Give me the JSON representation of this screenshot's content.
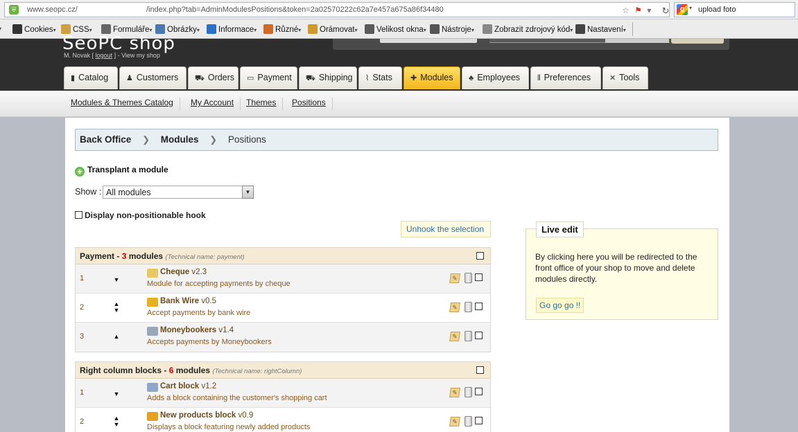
{
  "browser": {
    "url_host": "www.seopc.cz/",
    "url_path": "/index.php?tab=AdminModulesPositions&token=2a02570222c62a7e457a675a86f34480",
    "search_text": "upload foto"
  },
  "toolbar": {
    "items": [
      {
        "label": "Cookies",
        "icon": "person-icon",
        "color": "#333333"
      },
      {
        "label": "CSS",
        "icon": "wand-icon",
        "color": "#d0a040"
      },
      {
        "label": "Formuláře",
        "icon": "form-icon",
        "color": "#666666"
      },
      {
        "label": "Obrázky",
        "icon": "image-icon",
        "color": "#4a78b0"
      },
      {
        "label": "Informace",
        "icon": "info-icon",
        "color": "#2a6fc8"
      },
      {
        "label": "Různé",
        "icon": "misc-icon",
        "color": "#d06a2a"
      },
      {
        "label": "Orámovat",
        "icon": "pencil-icon",
        "color": "#d09a2a"
      },
      {
        "label": "Velikost okna",
        "icon": "resize-icon",
        "color": "#5a5a5a"
      },
      {
        "label": "Nástroje",
        "icon": "tools-icon",
        "color": "#555555"
      },
      {
        "label": "Zobrazit zdrojový kód",
        "icon": "source-icon",
        "color": "#888888"
      },
      {
        "label": "Nastavení",
        "icon": "settings-icon",
        "color": "#444444"
      }
    ]
  },
  "header": {
    "shop_title": "SeoPC shop",
    "user_name": "M. Novak",
    "logout": "logout",
    "view_shop": "View my shop"
  },
  "tabs": [
    {
      "label": "Catalog",
      "icon": "catalog-icon",
      "glyph": "▮"
    },
    {
      "label": "Customers",
      "icon": "customers-icon",
      "glyph": "♟"
    },
    {
      "label": "Orders",
      "icon": "cart-icon",
      "glyph": "⛟"
    },
    {
      "label": "Payment",
      "icon": "card-icon",
      "glyph": "▭"
    },
    {
      "label": "Shipping",
      "icon": "truck-icon",
      "glyph": "⛟"
    },
    {
      "label": "Stats",
      "icon": "chart-icon",
      "glyph": "⌇"
    },
    {
      "label": "Modules",
      "icon": "puzzle-icon",
      "glyph": "✚",
      "active": true
    },
    {
      "label": "Employees",
      "icon": "employees-icon",
      "glyph": "♣"
    },
    {
      "label": "Preferences",
      "icon": "sliders-icon",
      "glyph": "⫴"
    },
    {
      "label": "Tools",
      "icon": "wrench-icon",
      "glyph": "✕"
    }
  ],
  "subnav": [
    "Modules & Themes Catalog",
    "My Account",
    "Themes",
    "Positions"
  ],
  "breadcrumb": [
    "Back Office",
    "Modules",
    "Positions"
  ],
  "transplant_label": "Transplant a module",
  "show": {
    "label": "Show :",
    "value": "All modules"
  },
  "nonpositionable_label": "Display non-positionable hook",
  "unhook_label": "Unhook the selection",
  "hooks": [
    {
      "title": "Payment",
      "count_text": "3",
      "modules_word": "modules",
      "tech": "(Technical name: payment)",
      "modules": [
        {
          "pos": "1",
          "name": "Cheque",
          "version": "v2.3",
          "desc": "Module for accepting payments by cheque",
          "move": "down",
          "icon_color": "#e8c860"
        },
        {
          "pos": "2",
          "name": "Bank Wire",
          "version": "v0.5",
          "desc": "Accept payments by bank wire",
          "move": "both",
          "icon_color": "#e8b020"
        },
        {
          "pos": "3",
          "name": "Moneybookers",
          "version": "v1.4",
          "desc": "Accepts payments by Moneybookers",
          "move": "up",
          "icon_color": "#9aa7b8"
        }
      ]
    },
    {
      "title": "Right column blocks",
      "count_text": "6",
      "modules_word": "modules",
      "tech": "(Technical name: rightColumn)",
      "modules": [
        {
          "pos": "1",
          "name": "Cart block",
          "version": "v1.2",
          "desc": "Adds a block containing the customer's shopping cart",
          "move": "down",
          "icon_color": "#8fa8c8"
        },
        {
          "pos": "2",
          "name": "New products block",
          "version": "v0.9",
          "desc": "Displays a block featuring newly added products",
          "move": "both",
          "icon_color": "#e8a020"
        }
      ]
    }
  ],
  "live_edit": {
    "title": "Live edit",
    "text": "By clicking here you will be redirected to the front office of your shop to move and delete modules directly.",
    "button": "Go go go !!"
  }
}
